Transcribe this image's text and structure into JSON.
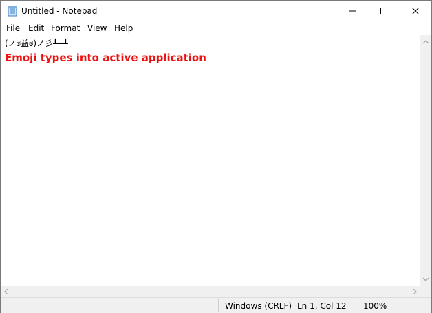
{
  "window": {
    "title": "Untitled - Notepad",
    "icon": "notepad-icon"
  },
  "menu": {
    "items": [
      "File",
      "Edit",
      "Format",
      "View",
      "Help"
    ]
  },
  "editor": {
    "text": "(ノಠ益ಠ)ノ彡┻━┻",
    "annotation": "Emoji types into active application",
    "annotation_color": "#ee1111"
  },
  "status": {
    "encoding": "Windows (CRLF)",
    "position": "Ln 1, Col 12",
    "zoom": "100%"
  }
}
